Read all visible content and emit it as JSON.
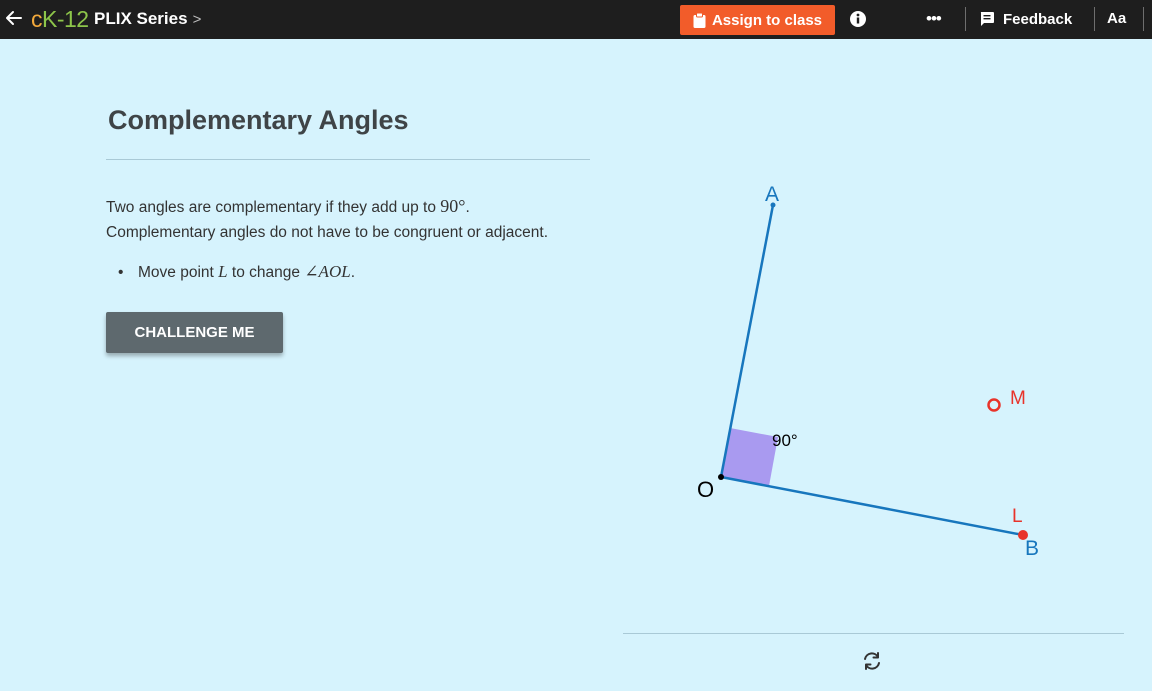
{
  "topbar": {
    "logo_c": "c",
    "logo_k12": "K-12",
    "series_label": "PLIX Series",
    "series_chevron": ">",
    "assign_label": "Assign to class",
    "more_label": "•••",
    "feedback_label": "Feedback",
    "font_size_label": "Aa",
    "accent_color": "#f25c2a"
  },
  "content": {
    "title": "Complementary Angles",
    "desc_line1_pre": "Two angles are complementary if they add up to ",
    "desc_line1_math": "90°",
    "desc_line1_post": ".",
    "desc_line2": "Complementary angles do not have to be congruent or adjacent.",
    "bullet_pre": "Move point ",
    "bullet_point": "L",
    "bullet_mid": " to change ",
    "bullet_angle": "∠AOL",
    "bullet_post": ".",
    "challenge_label": "CHALLENGE ME"
  },
  "diagram": {
    "label_A": "A",
    "label_O": "O",
    "label_B": "B",
    "label_L": "L",
    "label_M": "M",
    "angle_label": "90°",
    "line_color": "#1776bd",
    "point_color": "#e8332a",
    "angle_fill": "#a99af0"
  }
}
